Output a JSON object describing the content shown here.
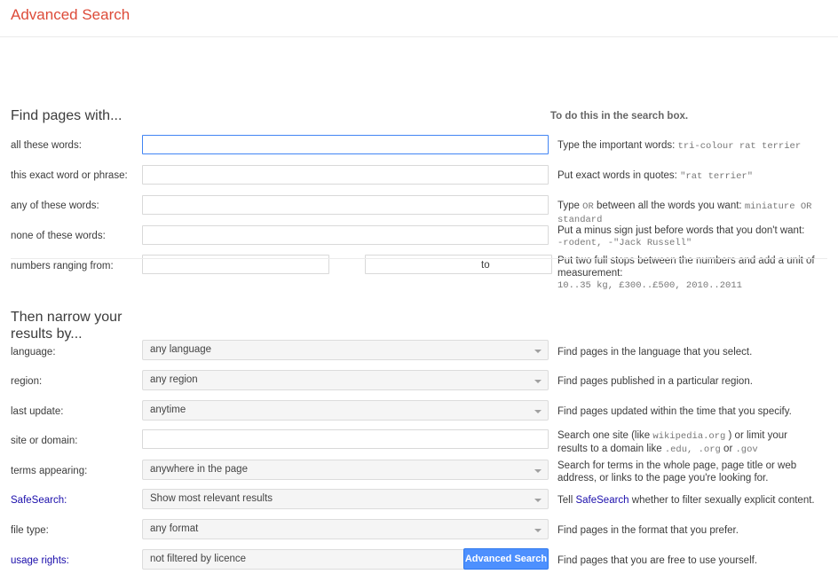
{
  "header": {
    "title": "Advanced Search"
  },
  "find_section": {
    "heading": "Find pages with...",
    "hint_heading": "To do this in the search box.",
    "rows": [
      {
        "label": "all these words:",
        "value": "",
        "hint_prefix": "Type the important words:",
        "hint_code": "tri-colour rat terrier",
        "hint_suffix": ""
      },
      {
        "label": "this exact word or phrase:",
        "value": "",
        "hint_prefix": "Put exact words in quotes:",
        "hint_code": "\"rat terrier\"",
        "hint_suffix": ""
      },
      {
        "label": "any of these words:",
        "value": "",
        "hint_prefix": "Type",
        "hint_code": "OR",
        "hint_suffix": "between all the words you want:",
        "hint_code2": "miniature OR standard"
      },
      {
        "label": "none of these words:",
        "value": "",
        "hint_prefix": "Put a minus sign just before words that you don't want:",
        "hint_code": "-rodent, -\"Jack Russell\"",
        "hint_suffix": ""
      },
      {
        "label": "numbers ranging from:",
        "value_from": "",
        "value_to": "",
        "separator": "to",
        "hint_prefix": "Put two full stops between the numbers and add a unit of measurement:",
        "hint_code": "10..35 kg, £300..£500, 2010..2011",
        "hint_suffix": ""
      }
    ]
  },
  "narrow_section": {
    "heading": "Then narrow your results by...",
    "rows": [
      {
        "label": "language:",
        "label_is_link": false,
        "control": "select",
        "value": "any language",
        "hint": "Find pages in the language that you select."
      },
      {
        "label": "region:",
        "label_is_link": false,
        "control": "select",
        "value": "any region",
        "hint": "Find pages published in a particular region."
      },
      {
        "label": "last update:",
        "label_is_link": false,
        "control": "select",
        "value": "anytime",
        "hint": "Find pages updated within the time that you specify."
      },
      {
        "label": "site or domain:",
        "label_is_link": false,
        "control": "text",
        "value": "",
        "hint_parts": {
          "a": "Search one site (like",
          "code1": "wikipedia.org",
          "b": ") or limit your results to a domain like",
          "code2": ".edu, .org",
          "c": "or",
          "code3": ".gov"
        }
      },
      {
        "label": "terms appearing:",
        "label_is_link": false,
        "control": "select",
        "value": "anywhere in the page",
        "hint": "Search for terms in the whole page, page title or web address, or links to the page you're looking for."
      },
      {
        "label": "SafeSearch:",
        "label_is_link": true,
        "control": "select",
        "value": "Show most relevant results",
        "hint_parts": {
          "a": "Tell",
          "link": "SafeSearch",
          "b": "whether to filter sexually explicit content."
        }
      },
      {
        "label": "file type:",
        "label_is_link": false,
        "control": "select",
        "value": "any format",
        "hint": "Find pages in the format that you prefer."
      },
      {
        "label": "usage rights:",
        "label_is_link": true,
        "control": "select",
        "value": "not filtered by licence",
        "hint": "Find pages that you are free to use yourself."
      }
    ]
  },
  "submit": {
    "label": "Advanced Search"
  },
  "colors": {
    "title_red": "#dd4b39",
    "link_blue": "#1a0dab",
    "button_blue": "#4d90fe",
    "focus_border": "#4285f4",
    "divider": "#ebebeb"
  }
}
